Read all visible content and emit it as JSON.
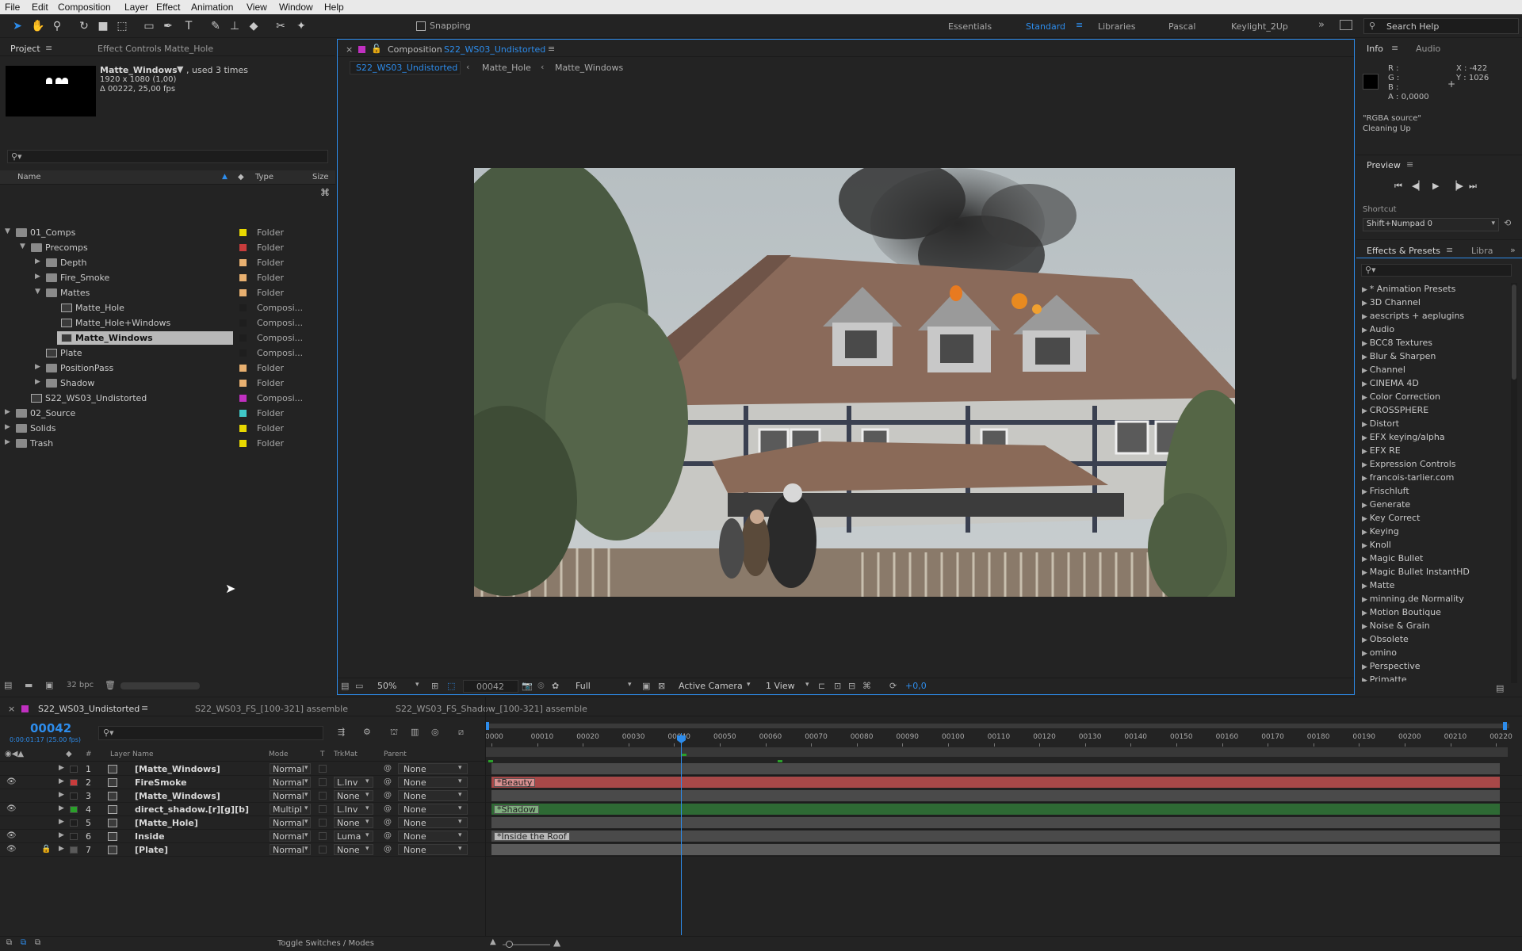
{
  "menu": [
    "File",
    "Edit",
    "Composition",
    "Layer",
    "Effect",
    "Animation",
    "View",
    "Window",
    "Help"
  ],
  "toolbar": {
    "snapping_label": "Snapping",
    "workspaces": [
      "Essentials",
      "Standard",
      "Libraries",
      "Pascal",
      "Keylight_2Up"
    ],
    "active_workspace": "Standard",
    "search_help_placeholder": "Search Help"
  },
  "project_panel": {
    "tab_project": "Project",
    "tab_effect_controls": "Effect Controls Matte_Hole",
    "selected_item": {
      "name": "Matte_Windows",
      "used": ", used 3 times",
      "dimensions": "1920 x 1080 (1,00)",
      "duration": "Δ 00222, 25,00 fps"
    },
    "columns": {
      "name": "Name",
      "type": "Type",
      "size": "Size"
    },
    "items": [
      {
        "name": "01_Comps",
        "type": "Folder",
        "color": "#e8d800",
        "indent": 0,
        "kind": "folder",
        "open": true
      },
      {
        "name": "Precomps",
        "type": "Folder",
        "color": "#c83c3c",
        "indent": 1,
        "kind": "folder",
        "open": true
      },
      {
        "name": "Depth",
        "type": "Folder",
        "color": "#e8b070",
        "indent": 2,
        "kind": "folder",
        "open": false
      },
      {
        "name": "Fire_Smoke",
        "type": "Folder",
        "color": "#e8b070",
        "indent": 2,
        "kind": "folder",
        "open": false
      },
      {
        "name": "Mattes",
        "type": "Folder",
        "color": "#e8b070",
        "indent": 2,
        "kind": "folder",
        "open": true
      },
      {
        "name": "Matte_Hole",
        "type": "Composi...",
        "color": "#1e1e1e",
        "indent": 3,
        "kind": "comp",
        "open": null
      },
      {
        "name": "Matte_Hole+Windows",
        "type": "Composi...",
        "color": "#1e1e1e",
        "indent": 3,
        "kind": "comp",
        "open": null
      },
      {
        "name": "Matte_Windows",
        "type": "Composi...",
        "color": "#1e1e1e",
        "indent": 3,
        "kind": "comp",
        "open": null,
        "selected": true
      },
      {
        "name": "Plate",
        "type": "Composi...",
        "color": "#1e1e1e",
        "indent": 2,
        "kind": "comp",
        "open": null
      },
      {
        "name": "PositionPass",
        "type": "Folder",
        "color": "#e8b070",
        "indent": 2,
        "kind": "folder",
        "open": false
      },
      {
        "name": "Shadow",
        "type": "Folder",
        "color": "#e8b070",
        "indent": 2,
        "kind": "folder",
        "open": false
      },
      {
        "name": "S22_WS03_Undistorted",
        "type": "Composi...",
        "color": "#c030c0",
        "indent": 1,
        "kind": "comp",
        "open": null
      },
      {
        "name": "02_Source",
        "type": "Folder",
        "color": "#40c8c8",
        "indent": 0,
        "kind": "folder",
        "open": false
      },
      {
        "name": "Solids",
        "type": "Folder",
        "color": "#e8d800",
        "indent": 0,
        "kind": "folder",
        "open": false
      },
      {
        "name": "Trash",
        "type": "Folder",
        "color": "#e8d800",
        "indent": 0,
        "kind": "folder",
        "open": false
      }
    ],
    "bpc": "32 bpc"
  },
  "viewer": {
    "tab_label": "Composition",
    "comp_name": "S22_WS03_Undistorted",
    "breadcrumbs": [
      "S22_WS03_Undistorted",
      "Matte_Hole",
      "Matte_Windows"
    ],
    "zoom": "50%",
    "timecode": "00042",
    "resolution": "Full",
    "camera": "Active Camera",
    "views": "1 View",
    "exposure": "+0,0"
  },
  "info_panel": {
    "tab_info": "Info",
    "tab_audio": "Audio",
    "r": "R :",
    "g": "G :",
    "b": "B :",
    "a": "A : 0,0000",
    "x": "X : -422",
    "y": "Y : 1026",
    "source": "\"RGBA source\"",
    "status": "Cleaning Up"
  },
  "preview_panel": {
    "title": "Preview",
    "shortcut_label": "Shortcut",
    "shortcut_value": "Shift+Numpad 0"
  },
  "effects_panel": {
    "tab_effects": "Effects & Presets",
    "tab_libraries": "Libra",
    "items": [
      "* Animation Presets",
      "3D Channel",
      "aescripts + aeplugins",
      "Audio",
      "BCC8 Textures",
      "Blur & Sharpen",
      "Channel",
      "CINEMA 4D",
      "Color Correction",
      "CROSSPHERE",
      "Distort",
      "EFX keying/alpha",
      "EFX RE",
      "Expression Controls",
      "francois-tarlier.com",
      "Frischluft",
      "Generate",
      "Key Correct",
      "Keying",
      "Knoll",
      "Magic Bullet",
      "Magic Bullet InstantHD",
      "Matte",
      "minning.de Normality",
      "Motion Boutique",
      "Noise & Grain",
      "Obsolete",
      "omino",
      "Perspective",
      "Primatte"
    ]
  },
  "timeline": {
    "tabs": [
      "S22_WS03_Undistorted",
      "S22_WS03_FS_[100-321] assemble",
      "S22_WS03_FS_Shadow_[100-321] assemble"
    ],
    "current_time": "00042",
    "current_time_sub": "0:00:01:17 (25.00 fps)",
    "col_layer_name": "Layer Name",
    "col_mode": "Mode",
    "col_t": "T",
    "col_trkmat": "TrkMat",
    "col_parent": "Parent",
    "col_num": "#",
    "ticks": [
      "0000",
      "00010",
      "00020",
      "00030",
      "00040",
      "00050",
      "00060",
      "00070",
      "00080",
      "00090",
      "00100",
      "00110",
      "00120",
      "00130",
      "00140",
      "00150",
      "00160",
      "00170",
      "00180",
      "00190",
      "00200",
      "00210",
      "00220"
    ],
    "layers": [
      {
        "num": "1",
        "name": "[Matte_Windows]",
        "mode": "Normal",
        "trkmat": "",
        "parent": "None",
        "color": "#1e1e1e",
        "eye": false,
        "lock": false,
        "bar_color": "#4a4a4a",
        "bar_label": ""
      },
      {
        "num": "2",
        "name": "FireSmoke",
        "mode": "Normal",
        "trkmat": "L.Inv",
        "parent": "None",
        "color": "#c83c3c",
        "eye": true,
        "lock": false,
        "bar_color": "#a84848",
        "bar_label": "*Beauty"
      },
      {
        "num": "3",
        "name": "[Matte_Windows]",
        "mode": "Normal",
        "trkmat": "None",
        "parent": "None",
        "color": "#1e1e1e",
        "eye": false,
        "lock": false,
        "bar_color": "#4a4a4a",
        "bar_label": ""
      },
      {
        "num": "4",
        "name": "direct_shadow.[r][g][b]",
        "mode": "Multipl",
        "trkmat": "L.Inv",
        "parent": "None",
        "color": "#2aa02a",
        "eye": true,
        "lock": false,
        "bar_color": "#2e6a34",
        "bar_label": "*Shadow"
      },
      {
        "num": "5",
        "name": "[Matte_Hole]",
        "mode": "Normal",
        "trkmat": "None",
        "parent": "None",
        "color": "#1e1e1e",
        "eye": false,
        "lock": false,
        "bar_color": "#4a4a4a",
        "bar_label": ""
      },
      {
        "num": "6",
        "name": "Inside",
        "mode": "Normal",
        "trkmat": "Luma",
        "parent": "None",
        "color": "#1e1e1e",
        "eye": true,
        "lock": false,
        "bar_color": "#4a4a4a",
        "bar_label": "*Inside the Roof"
      },
      {
        "num": "7",
        "name": "[Plate]",
        "mode": "Normal",
        "trkmat": "None",
        "parent": "None",
        "color": "#5a5a5a",
        "eye": true,
        "lock": true,
        "bar_color": "#5a5a5a",
        "bar_label": ""
      }
    ],
    "toggle_label": "Toggle Switches / Modes"
  }
}
